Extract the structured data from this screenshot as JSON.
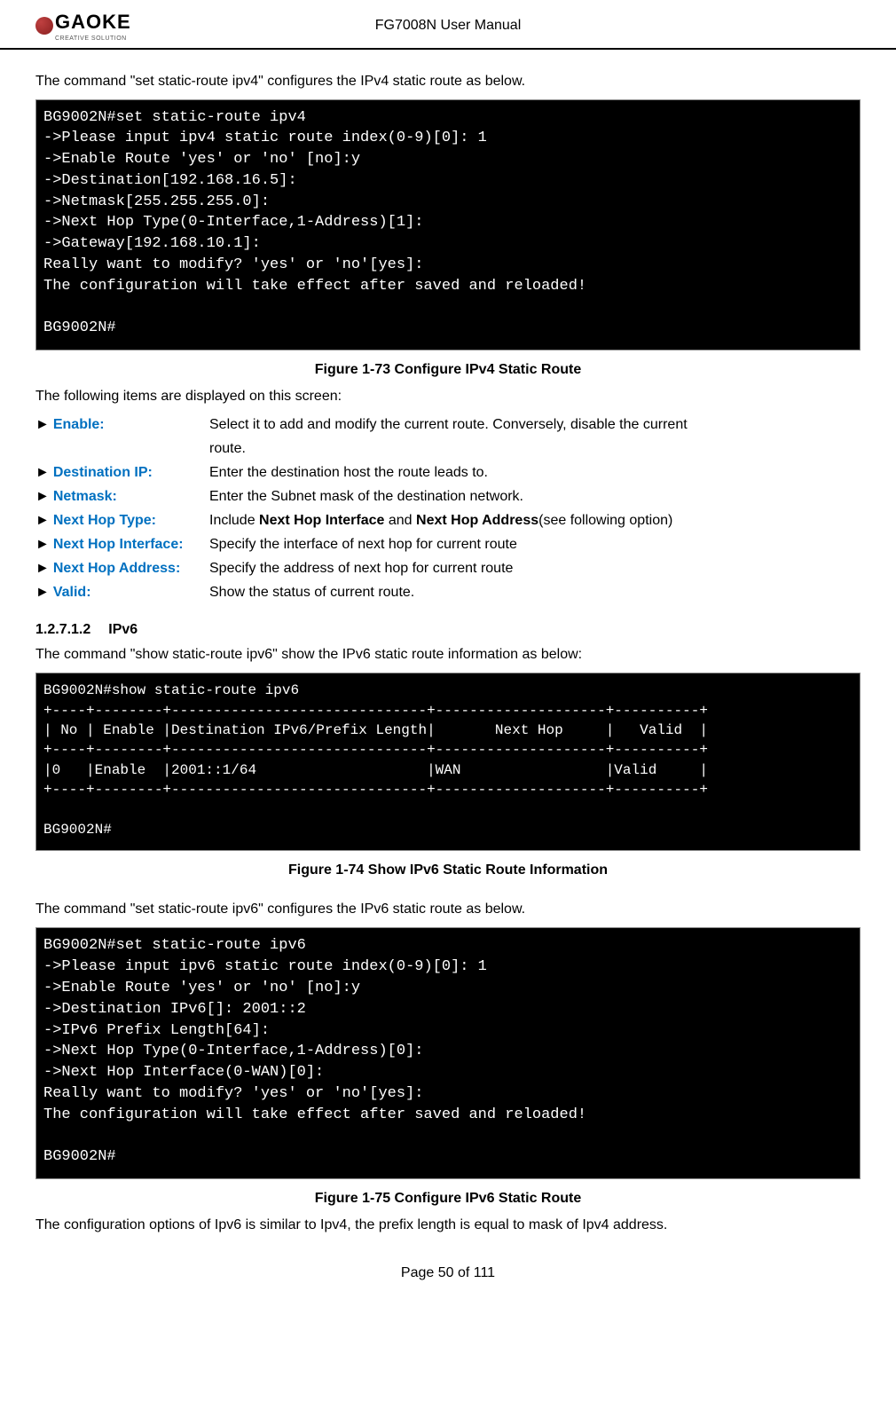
{
  "header": {
    "logo_text": "GAOKE",
    "logo_subtitle": "CREATIVE SOLUTION",
    "doc_title": "FG7008N User Manual"
  },
  "intro1": "The command \"set static-route ipv4\" configures the IPv4 static route as below.",
  "terminal1": {
    "l0": "BG9002N#set static-route ipv4",
    "l1": "->Please input ipv4 static route index(0-9)[0]: 1",
    "l2": "->Enable Route 'yes' or 'no' [no]:y",
    "l3": "->Destination[192.168.16.5]:",
    "l4": "->Netmask[255.255.255.0]:",
    "l5": "->Next Hop Type(0-Interface,1-Address)[1]:",
    "l6": "->Gateway[192.168.10.1]:",
    "l7": "Really want to modify? 'yes' or 'no'[yes]:",
    "l8": "The configuration will take effect after saved and reloaded!",
    "l9": "",
    "l10": "BG9002N#"
  },
  "fig1_caption": "Figure 1-73    Configure IPv4 Static Route",
  "intro2": "The following items are displayed on this screen:",
  "defs": {
    "enable": {
      "label": "Enable:",
      "desc_a": "Select it to add and modify the current route. Conversely, disable the current",
      "desc_b": "route."
    },
    "dest": {
      "label": "Destination IP:",
      "desc": "Enter the destination host the route leads to."
    },
    "netmask": {
      "label": "Netmask:",
      "desc": "Enter the Subnet mask of the destination network."
    },
    "nht": {
      "label": "Next Hop Type:",
      "desc_a": "Include ",
      "bold1": "Next Hop Interface",
      "mid": " and ",
      "bold2": "Next Hop Address",
      "desc_b": "(see following option)"
    },
    "nhi": {
      "label": "Next Hop Interface:",
      "desc": "Specify the interface of next hop for current route"
    },
    "nha": {
      "label": "Next Hop Address:",
      "desc": "Specify the address of next hop for current route"
    },
    "valid": {
      "label": "Valid:",
      "desc": "Show the status of current route."
    }
  },
  "section": {
    "num": "1.2.7.1.2",
    "title": "IPv6"
  },
  "intro3": "The command \"show static-route ipv6\" show the IPv6 static route information as below:",
  "terminal2": {
    "l0": "BG9002N#show static-route ipv6",
    "l1": "+----+--------+------------------------------+--------------------+----------+",
    "l2": "| No | Enable |Destination IPv6/Prefix Length|       Next Hop     |   Valid  |",
    "l3": "+----+--------+------------------------------+--------------------+----------+",
    "l4": "|0   |Enable  |2001::1/64                    |WAN                 |Valid     |",
    "l5": "+----+--------+------------------------------+--------------------+----------+",
    "l6": "",
    "l7": "BG9002N#"
  },
  "fig2_caption": "Figure 1-74    Show IPv6 Static Route Information",
  "intro4": "The command \"set static-route ipv6\" configures the IPv6 static route as below.",
  "terminal3": {
    "l0": "BG9002N#set static-route ipv6",
    "l1": "->Please input ipv6 static route index(0-9)[0]: 1",
    "l2": "->Enable Route 'yes' or 'no' [no]:y",
    "l3": "->Destination IPv6[]: 2001::2",
    "l4": "->IPv6 Prefix Length[64]:",
    "l5": "->Next Hop Type(0-Interface,1-Address)[0]:",
    "l6": "->Next Hop Interface(0-WAN)[0]:",
    "l7": "Really want to modify? 'yes' or 'no'[yes]:",
    "l8": "The configuration will take effect after saved and reloaded!",
    "l9": "",
    "l10": "BG9002N#"
  },
  "fig3_caption": "Figure 1-75    Configure IPv6 Static Route",
  "closing": "The configuration options of Ipv6 is similar to Ipv4, the prefix length is equal to mask of Ipv4 address.",
  "footer": "Page 50 of 111",
  "arrow": "►"
}
